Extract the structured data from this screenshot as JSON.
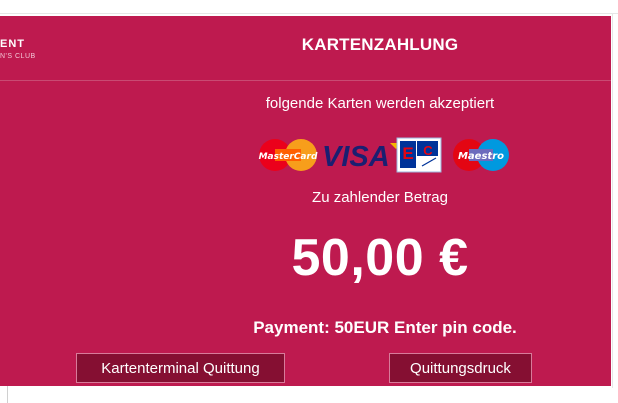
{
  "header": {
    "brand_name": "ENT",
    "brand_sub": "N'S CLUB",
    "title": "KARTENZAHLUNG"
  },
  "main": {
    "accepted_text": "folgende Karten werden akzeptiert",
    "cards": [
      {
        "name": "mastercard",
        "label": "MasterCard",
        "colors": [
          "#eb001b",
          "#f79e1b"
        ]
      },
      {
        "name": "visa",
        "label": "VISA",
        "color": "#1a1f71"
      },
      {
        "name": "ec",
        "label": "EC",
        "colors": [
          "#003399",
          "#e30613"
        ]
      },
      {
        "name": "maestro",
        "label": "Maestro",
        "colors": [
          "#e30613",
          "#0099df"
        ]
      }
    ],
    "amount_label": "Zu zahlender Betrag",
    "amount": "50,00 €",
    "status": "Payment: 50EUR Enter pin code."
  },
  "buttons": {
    "terminal_receipt": "Kartenterminal Quittung",
    "receipt_print": "Quittungsdruck"
  },
  "colors": {
    "panel": "#be1a4f",
    "button": "#850f32",
    "text": "#ffffff"
  }
}
